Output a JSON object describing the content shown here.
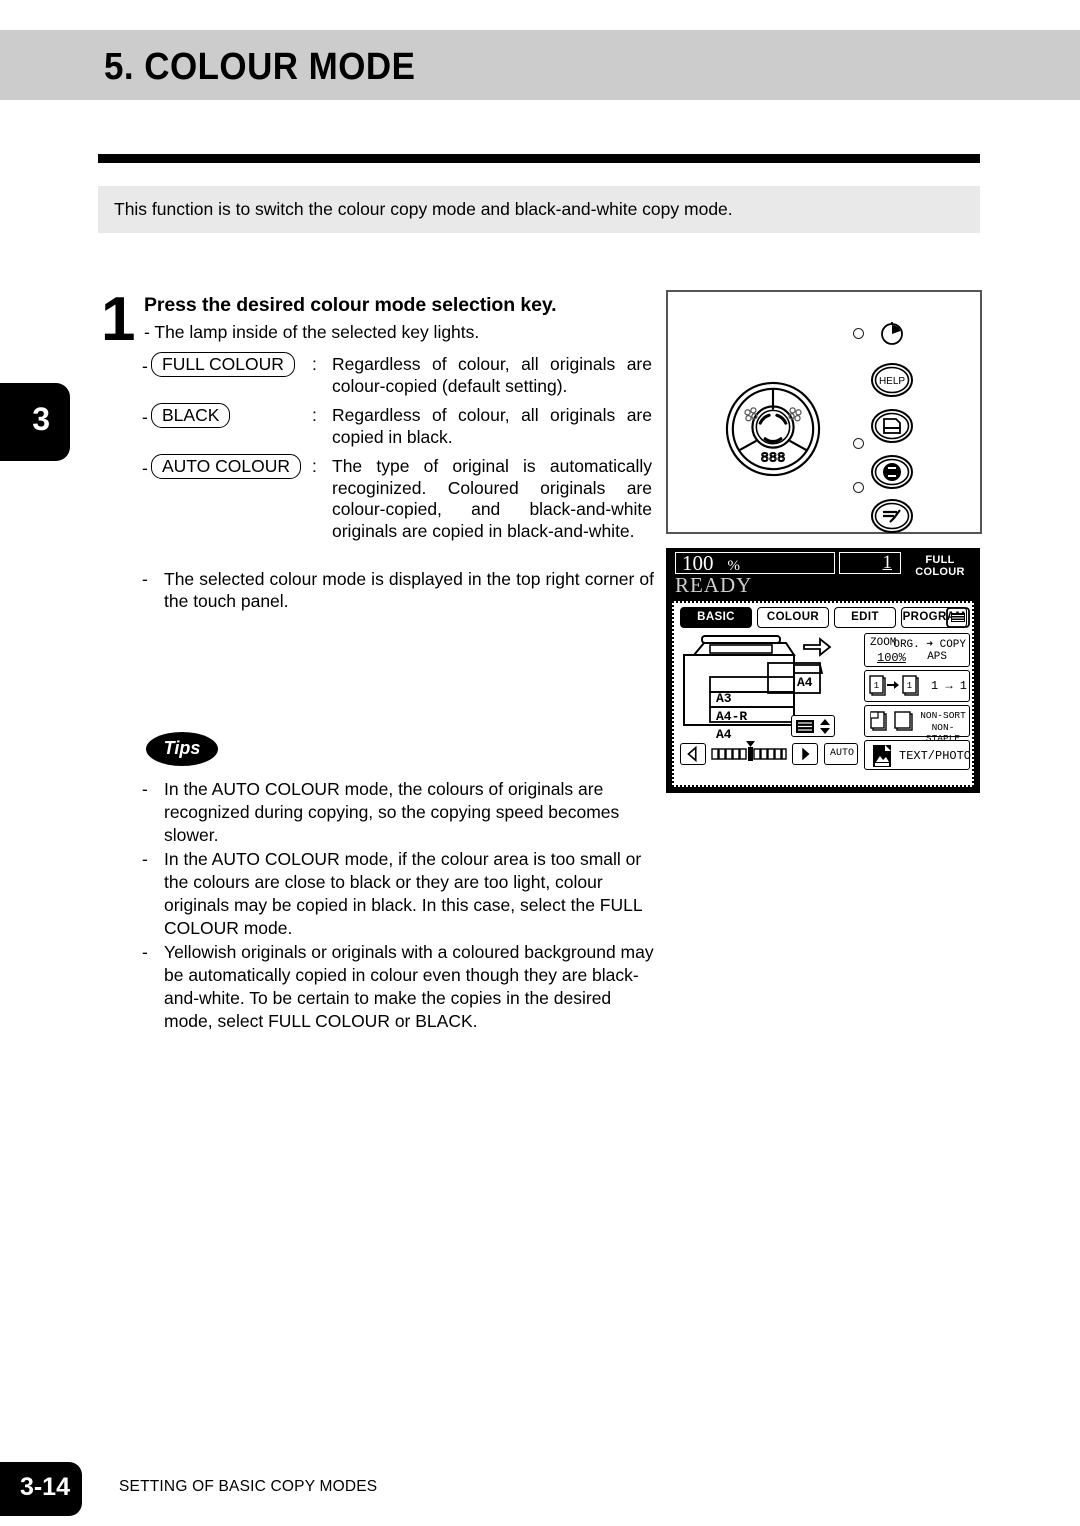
{
  "header": {
    "title": "5. COLOUR MODE"
  },
  "intro": {
    "text": "This function is to switch the colour copy mode and black-and-white copy mode."
  },
  "chapter_tab": {
    "number": "3"
  },
  "step": {
    "number": "1",
    "title": "Press the desired colour mode selection key.",
    "sub": "-  The lamp inside of the selected key lights.",
    "keys": [
      {
        "dash": "-",
        "label": "FULL COLOUR",
        "colon": ":",
        "description": "Regardless of colour, all originals are colour-copied (default setting)."
      },
      {
        "dash": "-",
        "label": "BLACK",
        "colon": ":",
        "description": "Regardless of colour, all originals are copied in black."
      },
      {
        "dash": "-",
        "label": "AUTO COLOUR",
        "colon": ":",
        "description": "The type of original is automatically recoginized. Coloured originals are colour-copied, and black-and-white originals are copied in black-and-white."
      }
    ],
    "note": {
      "dash": "-",
      "text": "The selected colour mode is displayed in the top right corner of the touch panel."
    }
  },
  "tips": {
    "badge": "Tips",
    "items": [
      {
        "dash": "-",
        "text": "In the AUTO COLOUR mode, the colours of originals are recognized during copying, so the copying speed becomes slower."
      },
      {
        "dash": "-",
        "text": "In the AUTO COLOUR mode, if the colour area is too small or the  colours are close to black or they are too light, colour originals may be copied in black.  In this case, select the FULL COLOUR mode."
      },
      {
        "dash": "-",
        "text": "Yellowish originals or originals with a coloured background may be automatically copied in colour even though they are black-and-white.  To be certain to make the copies in the desired mode, select FULL COLOUR or BLACK."
      }
    ]
  },
  "control_panel": {
    "colour_wheel": "colour-mode-wheel",
    "buttons": [
      {
        "name": "help-button",
        "label": "HELP"
      },
      {
        "name": "print-button",
        "label": ""
      },
      {
        "name": "interrupt-button",
        "label": ""
      },
      {
        "name": "energy-saver-button",
        "label": ""
      }
    ],
    "lamps": 3,
    "segment_indicator": "888"
  },
  "touch_panel": {
    "status": {
      "zoom": "100",
      "zoom_unit": "%",
      "copy_count": "1",
      "colour_mode": "FULL COLOUR",
      "message": "READY"
    },
    "tabs": [
      {
        "label": "BASIC",
        "selected": true
      },
      {
        "label": "COLOUR",
        "selected": false
      },
      {
        "label": "EDIT",
        "selected": false
      },
      {
        "label": "PROGRAM",
        "selected": false
      },
      {
        "label": "",
        "selected": false,
        "icon": "settings-list-icon"
      }
    ],
    "drawers": [
      {
        "label": ""
      },
      {
        "label": "A3"
      },
      {
        "label": "A4-R"
      },
      {
        "label": "A4"
      }
    ],
    "bypass_label": "A4",
    "density": {
      "left_arrow": "◁",
      "right_arrow": "▶",
      "auto_label": "AUTO"
    },
    "right_cells": [
      {
        "name": "zoom-cell",
        "l1": "ZOOM",
        "l2": "100%",
        "r1": "ORG. ➜ COPY",
        "r2": "APS"
      },
      {
        "name": "duplex-cell",
        "text": "1 → 1"
      },
      {
        "name": "finisher-cell",
        "l1": "NON-SORT",
        "l2": "NON-STAPLE"
      },
      {
        "name": "original-mode-cell",
        "text": "TEXT/PHOTO"
      }
    ]
  },
  "footer": {
    "page": "3-14",
    "section": "SETTING OF BASIC COPY MODES"
  },
  "colors": {
    "header_band": "#cccccc",
    "intro_box": "#e9e9e9",
    "ink": "#000000"
  }
}
